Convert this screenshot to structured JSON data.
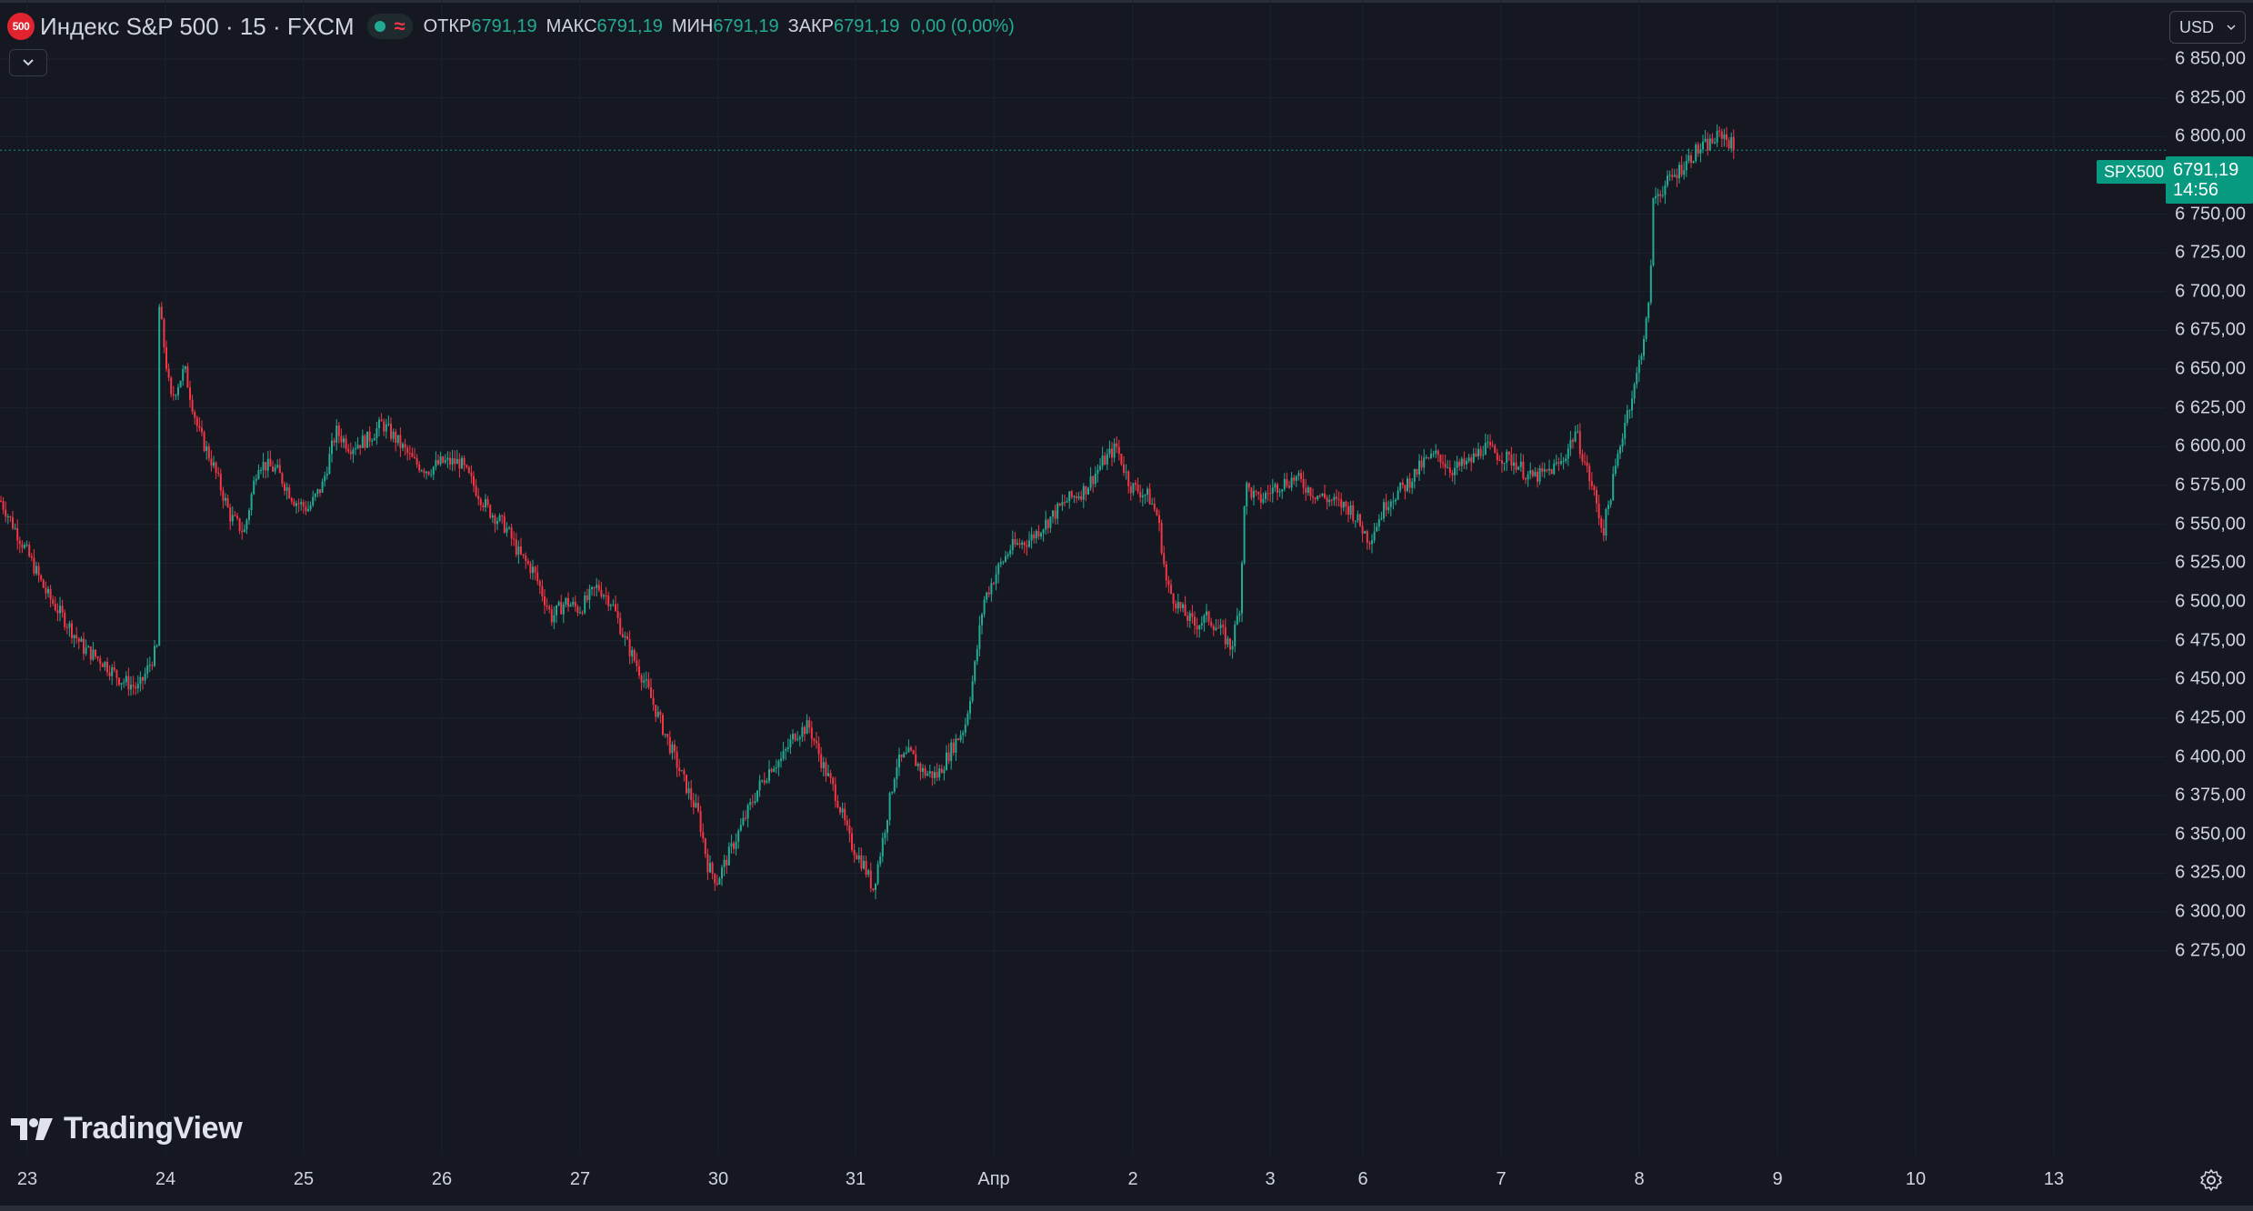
{
  "header": {
    "symbol_badge": "500",
    "symbol_title": "Индекс S&P 500 · 15 · FXCM",
    "ohlc": [
      {
        "label": "ОТКР",
        "value": "6791,19"
      },
      {
        "label": "МАКС",
        "value": "6791,19"
      },
      {
        "label": "МИН",
        "value": "6791,19"
      },
      {
        "label": "ЗАКР",
        "value": "6791,19"
      }
    ],
    "change": "0,00 (0,00%)"
  },
  "currency": "USD",
  "price_tag": {
    "symbol": "SPX500",
    "price": "6791,19",
    "countdown": "14:56"
  },
  "price_axis": [
    {
      "label": "6 850,00",
      "value": 6850
    },
    {
      "label": "6 825,00",
      "value": 6825
    },
    {
      "label": "6 800,00",
      "value": 6800
    },
    {
      "label": "6 750,00",
      "value": 6750
    },
    {
      "label": "6 725,00",
      "value": 6725
    },
    {
      "label": "6 700,00",
      "value": 6700
    },
    {
      "label": "6 675,00",
      "value": 6675
    },
    {
      "label": "6 650,00",
      "value": 6650
    },
    {
      "label": "6 625,00",
      "value": 6625
    },
    {
      "label": "6 600,00",
      "value": 6600
    },
    {
      "label": "6 575,00",
      "value": 6575
    },
    {
      "label": "6 550,00",
      "value": 6550
    },
    {
      "label": "6 525,00",
      "value": 6525
    },
    {
      "label": "6 500,00",
      "value": 6500
    },
    {
      "label": "6 475,00",
      "value": 6475
    },
    {
      "label": "6 450,00",
      "value": 6450
    },
    {
      "label": "6 425,00",
      "value": 6425
    },
    {
      "label": "6 400,00",
      "value": 6400
    },
    {
      "label": "6 375,00",
      "value": 6375
    },
    {
      "label": "6 350,00",
      "value": 6350
    },
    {
      "label": "6 325,00",
      "value": 6325
    },
    {
      "label": "6 300,00",
      "value": 6300
    },
    {
      "label": "6 275,00",
      "value": 6275
    }
  ],
  "time_axis": [
    "23",
    "24",
    "25",
    "26",
    "27",
    "30",
    "31",
    "Апр",
    "2",
    "3",
    "6",
    "7",
    "8",
    "9",
    "10",
    "13"
  ],
  "watermark": "TradingView",
  "colors": {
    "up": "#22ab94",
    "down": "#f23645",
    "background": "#151821",
    "grid": "#1f2230",
    "price_tag": "#089981"
  },
  "price_path": [
    [
      0,
      6565
    ],
    [
      0.6,
      6530
    ],
    [
      1,
      6505
    ],
    [
      1.4,
      6488
    ],
    [
      1.8,
      6470
    ],
    [
      2.2,
      6462
    ],
    [
      2.6,
      6450
    ],
    [
      3.0,
      6444
    ],
    [
      3.4,
      6470
    ],
    [
      3.45,
      6690
    ],
    [
      3.7,
      6630
    ],
    [
      4.0,
      6650
    ],
    [
      4.3,
      6610
    ],
    [
      4.6,
      6590
    ],
    [
      5.0,
      6555
    ],
    [
      5.3,
      6545
    ],
    [
      5.6,
      6590
    ],
    [
      6.0,
      6585
    ],
    [
      6.4,
      6565
    ],
    [
      6.7,
      6560
    ],
    [
      7.0,
      6575
    ],
    [
      7.3,
      6610
    ],
    [
      7.6,
      6600
    ],
    [
      8.0,
      6605
    ],
    [
      8.3,
      6615
    ],
    [
      8.6,
      6605
    ],
    [
      9.0,
      6590
    ],
    [
      9.3,
      6585
    ],
    [
      9.6,
      6590
    ],
    [
      10.0,
      6590
    ],
    [
      10.3,
      6575
    ],
    [
      10.6,
      6560
    ],
    [
      11.0,
      6548
    ],
    [
      11.3,
      6530
    ],
    [
      11.6,
      6520
    ],
    [
      12.0,
      6490
    ],
    [
      12.3,
      6500
    ],
    [
      12.6,
      6495
    ],
    [
      13.0,
      6510
    ],
    [
      13.3,
      6500
    ],
    [
      13.6,
      6475
    ],
    [
      14.0,
      6450
    ],
    [
      14.4,
      6420
    ],
    [
      14.8,
      6390
    ],
    [
      15.2,
      6362
    ],
    [
      15.4,
      6330
    ],
    [
      15.6,
      6320
    ],
    [
      15.9,
      6340
    ],
    [
      16.2,
      6360
    ],
    [
      16.5,
      6380
    ],
    [
      16.8,
      6395
    ],
    [
      17.0,
      6398
    ],
    [
      17.3,
      6415
    ],
    [
      17.6,
      6420
    ],
    [
      17.9,
      6395
    ],
    [
      18.2,
      6375
    ],
    [
      18.5,
      6345
    ],
    [
      18.8,
      6330
    ],
    [
      19.0,
      6315
    ],
    [
      19.2,
      6345
    ],
    [
      19.5,
      6395
    ],
    [
      19.8,
      6402
    ],
    [
      20.1,
      6390
    ],
    [
      20.4,
      6388
    ],
    [
      20.7,
      6405
    ],
    [
      21.0,
      6420
    ],
    [
      21.2,
      6455
    ],
    [
      21.4,
      6500
    ],
    [
      21.7,
      6520
    ],
    [
      22.0,
      6535
    ],
    [
      22.4,
      6540
    ],
    [
      22.8,
      6552
    ],
    [
      23.2,
      6565
    ],
    [
      23.6,
      6572
    ],
    [
      24.0,
      6590
    ],
    [
      24.3,
      6600
    ],
    [
      24.6,
      6575
    ],
    [
      25.0,
      6568
    ],
    [
      25.2,
      6555
    ],
    [
      25.4,
      6510
    ],
    [
      25.7,
      6495
    ],
    [
      26.0,
      6485
    ],
    [
      26.3,
      6490
    ],
    [
      26.6,
      6480
    ],
    [
      26.8,
      6470
    ],
    [
      27.0,
      6500
    ],
    [
      27.1,
      6575
    ],
    [
      27.4,
      6565
    ],
    [
      27.8,
      6575
    ],
    [
      28.2,
      6580
    ],
    [
      28.6,
      6570
    ],
    [
      29.0,
      6565
    ],
    [
      29.4,
      6560
    ],
    [
      29.6,
      6550
    ],
    [
      29.8,
      6540
    ],
    [
      30.2,
      6565
    ],
    [
      30.6,
      6575
    ],
    [
      31.0,
      6590
    ],
    [
      31.3,
      6595
    ],
    [
      31.6,
      6585
    ],
    [
      32.0,
      6590
    ],
    [
      32.3,
      6600
    ],
    [
      32.6,
      6595
    ],
    [
      33.0,
      6590
    ],
    [
      33.3,
      6580
    ],
    [
      33.6,
      6582
    ],
    [
      34.0,
      6590
    ],
    [
      34.3,
      6610
    ],
    [
      34.5,
      6590
    ],
    [
      34.7,
      6570
    ],
    [
      34.9,
      6545
    ],
    [
      35.1,
      6575
    ],
    [
      35.4,
      6620
    ],
    [
      35.6,
      6640
    ],
    [
      35.9,
      6690
    ],
    [
      36.0,
      6760
    ],
    [
      36.3,
      6770
    ],
    [
      36.6,
      6780
    ],
    [
      36.9,
      6790
    ],
    [
      37.2,
      6795
    ],
    [
      37.5,
      6802
    ],
    [
      37.7,
      6795
    ],
    [
      37.75,
      6791
    ]
  ]
}
